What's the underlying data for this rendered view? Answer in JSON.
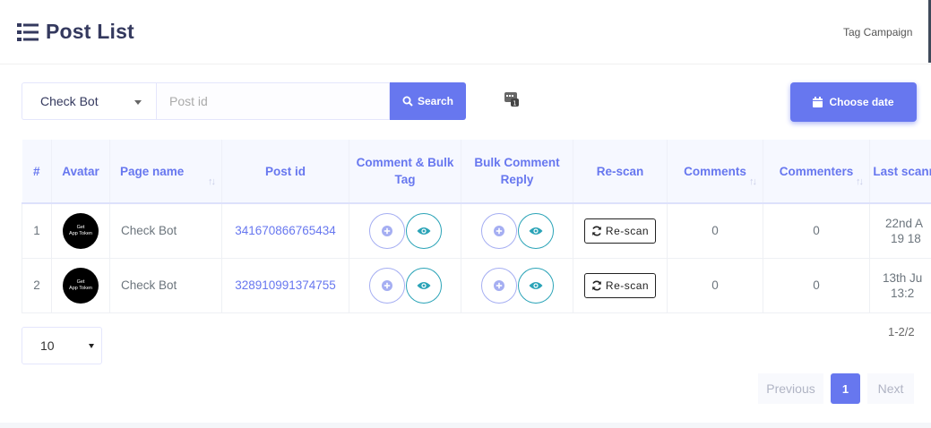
{
  "header": {
    "title": "Post List",
    "tag_campaign": "Tag Campaign"
  },
  "filter": {
    "bot_select": "Check Bot",
    "post_id_placeholder": "Post id",
    "search_label": "Search",
    "choose_date_label": "Choose date"
  },
  "table": {
    "headers": {
      "num": "#",
      "avatar": "Avatar",
      "page_name": "Page name",
      "post_id": "Post id",
      "comment_bulk_tag": "Comment & Bulk Tag",
      "bulk_comment_reply": "Bulk Comment Reply",
      "rescan": "Re-scan",
      "comments": "Comments",
      "commenters": "Commenters",
      "last_scanned": "Last scanned"
    },
    "rows": [
      {
        "num": "1",
        "avatar_line1": "Get",
        "avatar_line2": "App Token",
        "page_name": "Check Bot",
        "post_id": "341670866765434",
        "rescan": "Re-scan",
        "comments": "0",
        "commenters": "0",
        "last_line1": "22nd A",
        "last_line2": "19 18"
      },
      {
        "num": "2",
        "avatar_line1": "Get",
        "avatar_line2": "App Token",
        "page_name": "Check Bot",
        "post_id": "328910991374755",
        "rescan": "Re-scan",
        "comments": "0",
        "commenters": "0",
        "last_line1": "13th Ju",
        "last_line2": "13:2"
      }
    ]
  },
  "pagination": {
    "page_size": "10",
    "info": "1-2/2",
    "previous": "Previous",
    "current": "1",
    "next": "Next"
  },
  "colors": {
    "accent": "#6777ef",
    "eye": "#2aa3b7"
  }
}
